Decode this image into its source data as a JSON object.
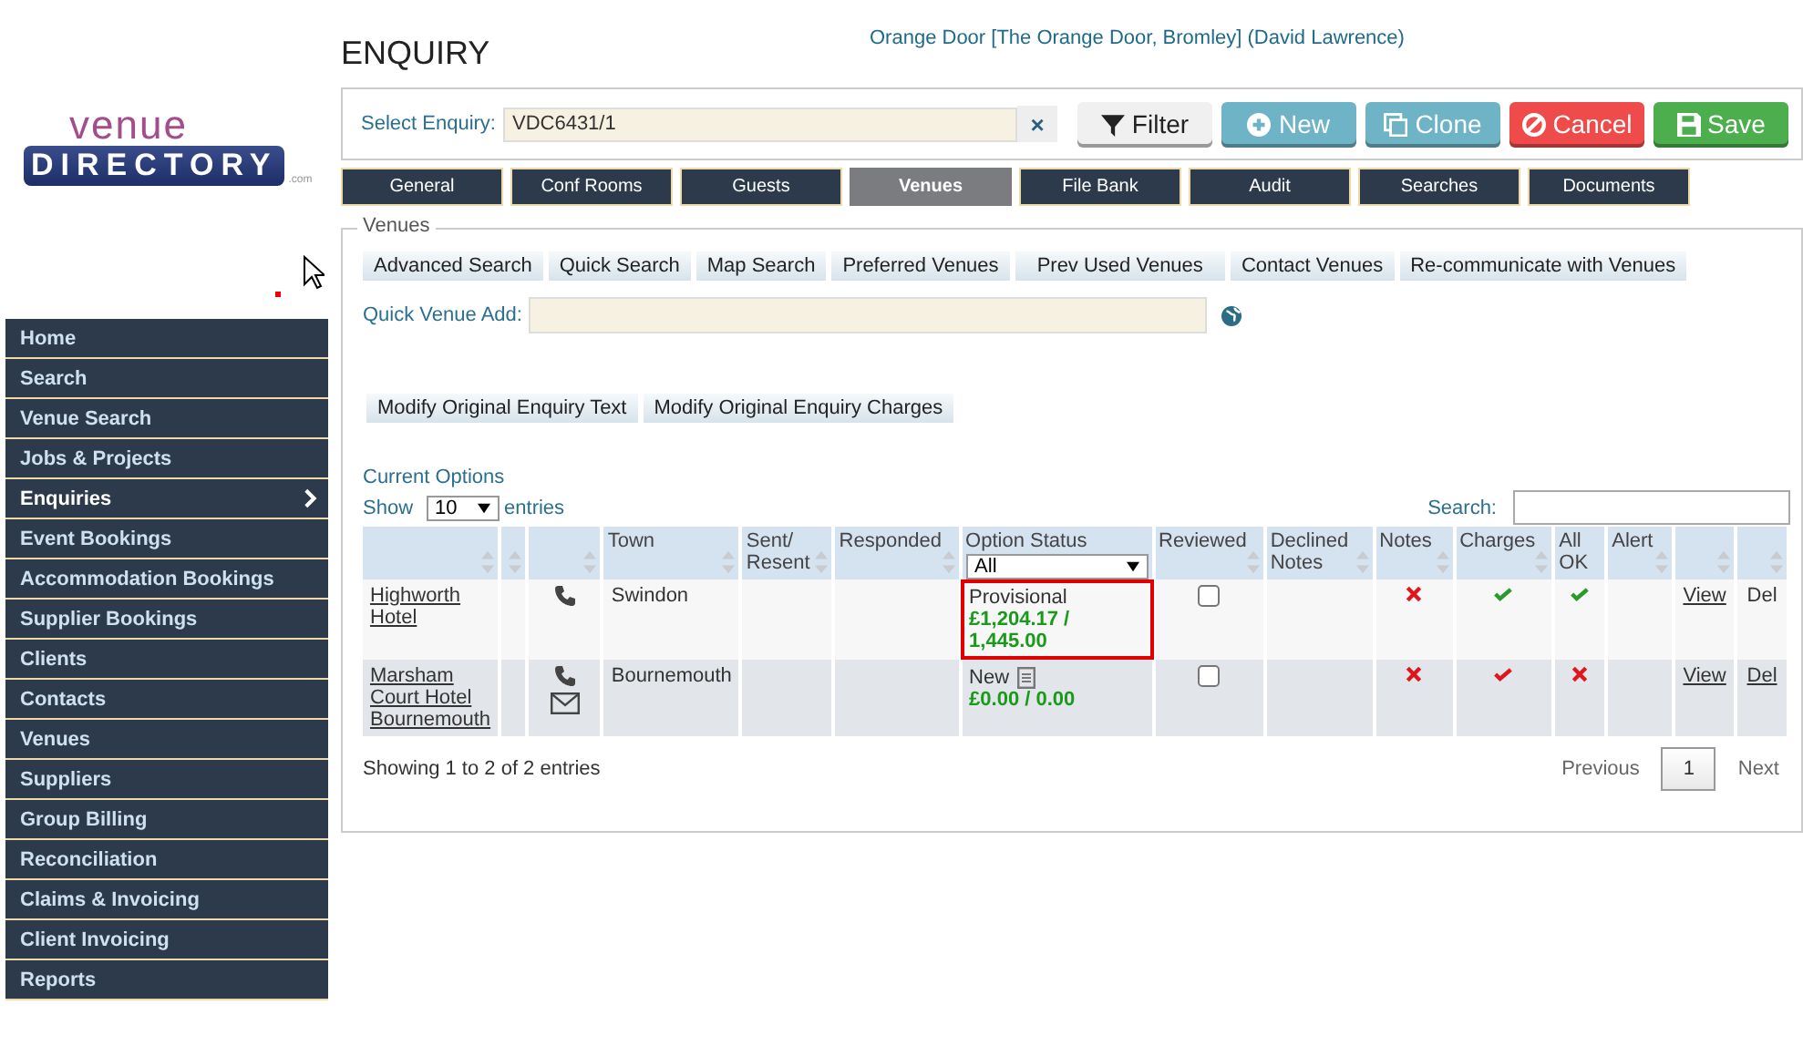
{
  "logo": {
    "top": "venue",
    "main": "DIRECTORY",
    "suffix": ".com"
  },
  "sidebar": {
    "items": [
      {
        "label": "Home",
        "selected": false
      },
      {
        "label": "Search",
        "selected": false
      },
      {
        "label": "Venue Search",
        "selected": false
      },
      {
        "label": "Jobs & Projects",
        "selected": false
      },
      {
        "label": "Enquiries",
        "selected": true
      },
      {
        "label": "Event Bookings",
        "selected": false
      },
      {
        "label": "Accommodation Bookings",
        "selected": false
      },
      {
        "label": "Supplier Bookings",
        "selected": false
      },
      {
        "label": "Clients",
        "selected": false
      },
      {
        "label": "Contacts",
        "selected": false
      },
      {
        "label": "Venues",
        "selected": false
      },
      {
        "label": "Suppliers",
        "selected": false
      },
      {
        "label": "Group Billing",
        "selected": false
      },
      {
        "label": "Reconciliation",
        "selected": false
      },
      {
        "label": "Claims & Invoicing",
        "selected": false
      },
      {
        "label": "Client Invoicing",
        "selected": false
      },
      {
        "label": "Reports",
        "selected": false
      }
    ]
  },
  "page_title": "ENQUIRY",
  "user_info": "Orange Door [The Orange Door, Bromley] (David Lawrence)",
  "enquiry": {
    "label": "Select Enquiry:",
    "value": "VDC6431/1",
    "clear": "×"
  },
  "actions": [
    {
      "kind": "filter",
      "label": "Filter"
    },
    {
      "kind": "new",
      "label": "New"
    },
    {
      "kind": "clone",
      "label": "Clone"
    },
    {
      "kind": "cancel",
      "label": "Cancel"
    },
    {
      "kind": "save",
      "label": "Save"
    }
  ],
  "tabs": [
    {
      "label": "General",
      "selected": false
    },
    {
      "label": "Conf Rooms",
      "selected": false
    },
    {
      "label": "Guests",
      "selected": false
    },
    {
      "label": "Venues",
      "selected": true
    },
    {
      "label": "File Bank",
      "selected": false
    },
    {
      "label": "Audit",
      "selected": false
    },
    {
      "label": "Searches",
      "selected": false
    },
    {
      "label": "Documents",
      "selected": false
    }
  ],
  "venues": {
    "legend": "Venues",
    "buttons": [
      "Advanced Search",
      "Quick Search",
      "Map Search",
      "Preferred Venues",
      "Prev Used Venues",
      "Contact Venues",
      "Re-communicate with Venues"
    ],
    "quick_add": {
      "label": "Quick Venue Add:"
    },
    "modify_buttons": [
      "Modify Original Enquiry Text",
      "Modify Original Enquiry Charges"
    ],
    "options_title": "Current Options",
    "show": {
      "before": "Show",
      "value": "10",
      "after": "entries"
    },
    "search": {
      "label": "Search:"
    },
    "table": {
      "columns": [
        {
          "sortable": true
        },
        {
          "sortable": true
        },
        {
          "sortable": true
        },
        {
          "label": "Town",
          "sortable": true
        },
        {
          "label": "Sent/ Resent",
          "sortable": true
        },
        {
          "label": "Responded",
          "sortable": true
        },
        {
          "label": "Option Status",
          "sortable": false,
          "filter": "All"
        },
        {
          "label": "Reviewed",
          "sortable": true
        },
        {
          "label": "Declined Notes",
          "sortable": true
        },
        {
          "label": "Notes",
          "sortable": true
        },
        {
          "label": "Charges",
          "sortable": true
        },
        {
          "label": "All OK",
          "sortable": false
        },
        {
          "label": "Alert",
          "sortable": true
        },
        {
          "sortable": true
        },
        {
          "sortable": true
        }
      ],
      "rows": [
        {
          "venue": "Highworth Hotel",
          "has_phone": true,
          "has_email": false,
          "town": "Swindon",
          "status": "Provisional",
          "note_icon": false,
          "amount": "£1,204.17 / 1,445.00",
          "highlighted": true,
          "reviewed": false,
          "notes_ok": false,
          "charges_ok": true,
          "charges_confirmed": true,
          "all_ok": true,
          "view": "View",
          "del": "Del",
          "del_link": false
        },
        {
          "venue": "Marsham Court Hotel Bournemouth",
          "has_phone": true,
          "has_email": true,
          "town": "Bournemouth",
          "status": "New",
          "note_icon": true,
          "amount": "£0.00 / 0.00",
          "highlighted": false,
          "reviewed": false,
          "notes_ok": false,
          "charges_ok": true,
          "charges_confirmed": false,
          "all_ok": false,
          "view": "View",
          "del": "Del",
          "del_link": true
        }
      ]
    },
    "info": "Showing 1 to 2 of 2 entries",
    "pager": {
      "previous": "Previous",
      "pages": [
        {
          "label": "1",
          "selected": true
        }
      ],
      "next": "Next"
    }
  }
}
